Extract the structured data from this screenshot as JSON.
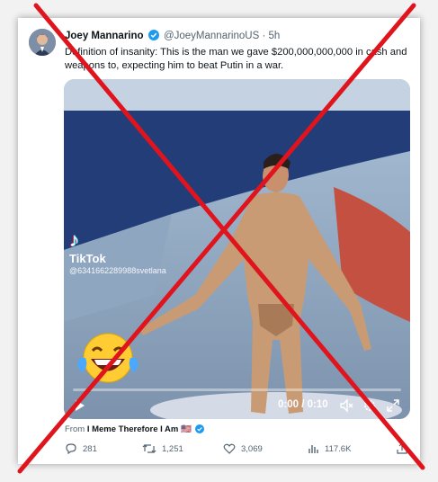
{
  "tweet": {
    "author_name": "Joey Mannarino",
    "handle": "@JoeyMannarinoUS",
    "separator": "·",
    "time": "5h",
    "text": "Definition of insanity: This is the man we gave $200,000,000,000 in cash and weapons to, expecting him to beat Putin in a war.",
    "source_prefix": "From",
    "source_name": "I Meme Therefore I Am",
    "flag": "🇺🇸"
  },
  "video": {
    "watermark_brand": "TikTok",
    "watermark_user": "@6341662289988svetlana",
    "time_display": "0:00 / 0:10",
    "progress": 0
  },
  "actions": {
    "replies": "281",
    "reposts": "1,251",
    "likes": "3,069",
    "views": "117.6K"
  },
  "colors": {
    "verified": "#1d9bf0",
    "overlay_x": "#e0141c",
    "secondary_text": "#536471"
  }
}
